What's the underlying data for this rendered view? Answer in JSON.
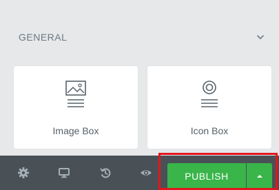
{
  "section": {
    "title": "GENERAL",
    "chevron_icon": "chevron-down-icon"
  },
  "widgets": [
    {
      "label": "Image Box",
      "icon": "image-box-icon"
    },
    {
      "label": "Icon Box",
      "icon": "icon-box-icon"
    }
  ],
  "bottom_bar": {
    "tools": [
      {
        "icon": "gear-icon"
      },
      {
        "icon": "desktop-icon"
      },
      {
        "icon": "history-icon"
      },
      {
        "icon": "eye-icon"
      }
    ],
    "publish_label": "PUBLISH",
    "publish_menu_icon": "caret-up-icon"
  },
  "colors": {
    "panel_background": "#e6e8ea",
    "bottom_bar": "#495157",
    "publish_button": "#39b54a",
    "highlight": "#e3161d"
  }
}
